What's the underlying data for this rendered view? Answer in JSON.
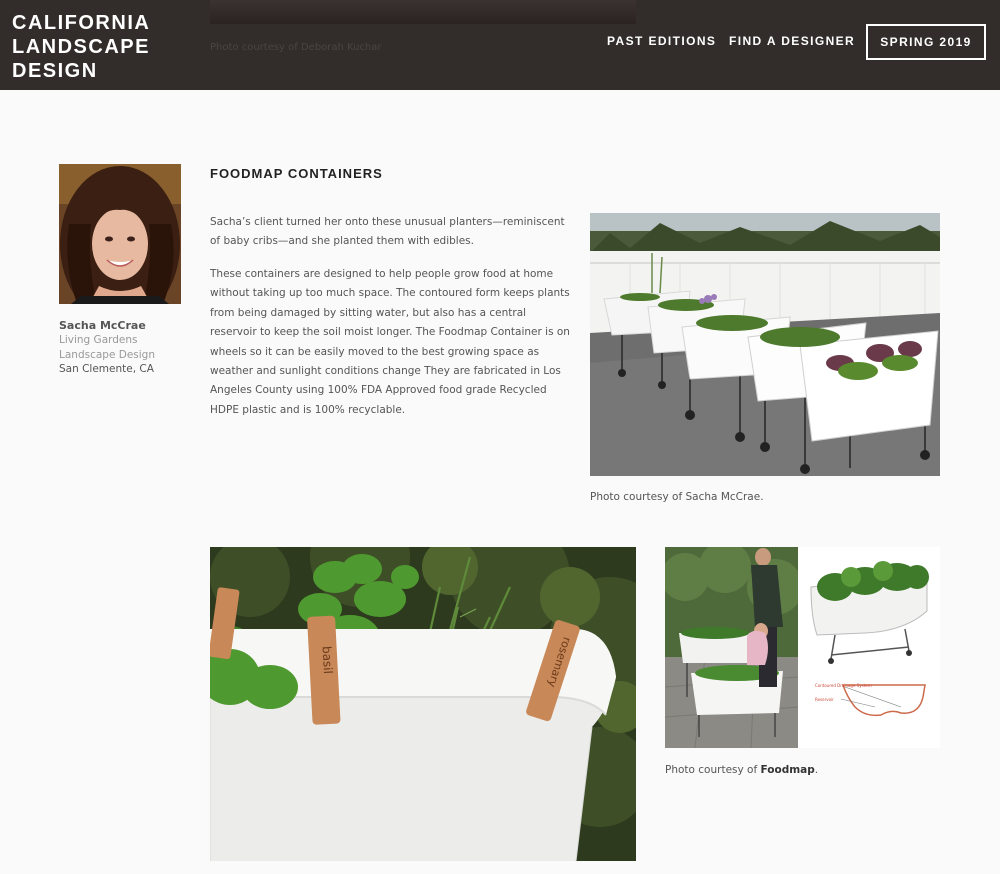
{
  "header": {
    "logo_line1": "CALIFORNIA",
    "logo_line2": "LANDSCAPE",
    "logo_line3": "DESIGN",
    "prev_caption": "Photo courtesy of Deborah Kuchar",
    "nav": {
      "past_editions": "PAST EDITIONS",
      "find_designer": "FIND A DESIGNER",
      "spring": "SPRING 2019"
    }
  },
  "designer": {
    "name": "Sacha McCrae",
    "firm_line1": "Living Gardens",
    "firm_line2": "Landscape Design",
    "location": "San Clemente, CA"
  },
  "article": {
    "title": "FOODMAP CONTAINERS",
    "para1": "Sacha’s client turned her onto these unusual planters—reminiscent of baby cribs—and she planted them with edibles.",
    "para2": "These containers are designed to help people grow food at home without taking up too much space. The contoured form keeps plants from being damaged by sitting water, but also has a central reservoir to keep the soil moist longer. The Foodmap Container is on wheels so it can be easily moved to the best growing space as weather and sunlight conditions change They are fabricated in Los Angeles County using 100% FDA Approved food grade Recycled HDPE plastic and is 100% recyclable.",
    "caption1": "Photo courtesy of Sacha McCrae.",
    "caption3_prefix": "Photo courtesy of ",
    "caption3_bold": "Foodmap",
    "caption3_suffix": ".",
    "stake_left": "basil",
    "stake_right": "rosemary",
    "diagram_label1": "Contoured Drainage System",
    "diagram_label2": "Reservoir"
  },
  "colors": {
    "header_bg": "#322d2b",
    "page_bg": "#fafafa",
    "text": "#555555"
  }
}
